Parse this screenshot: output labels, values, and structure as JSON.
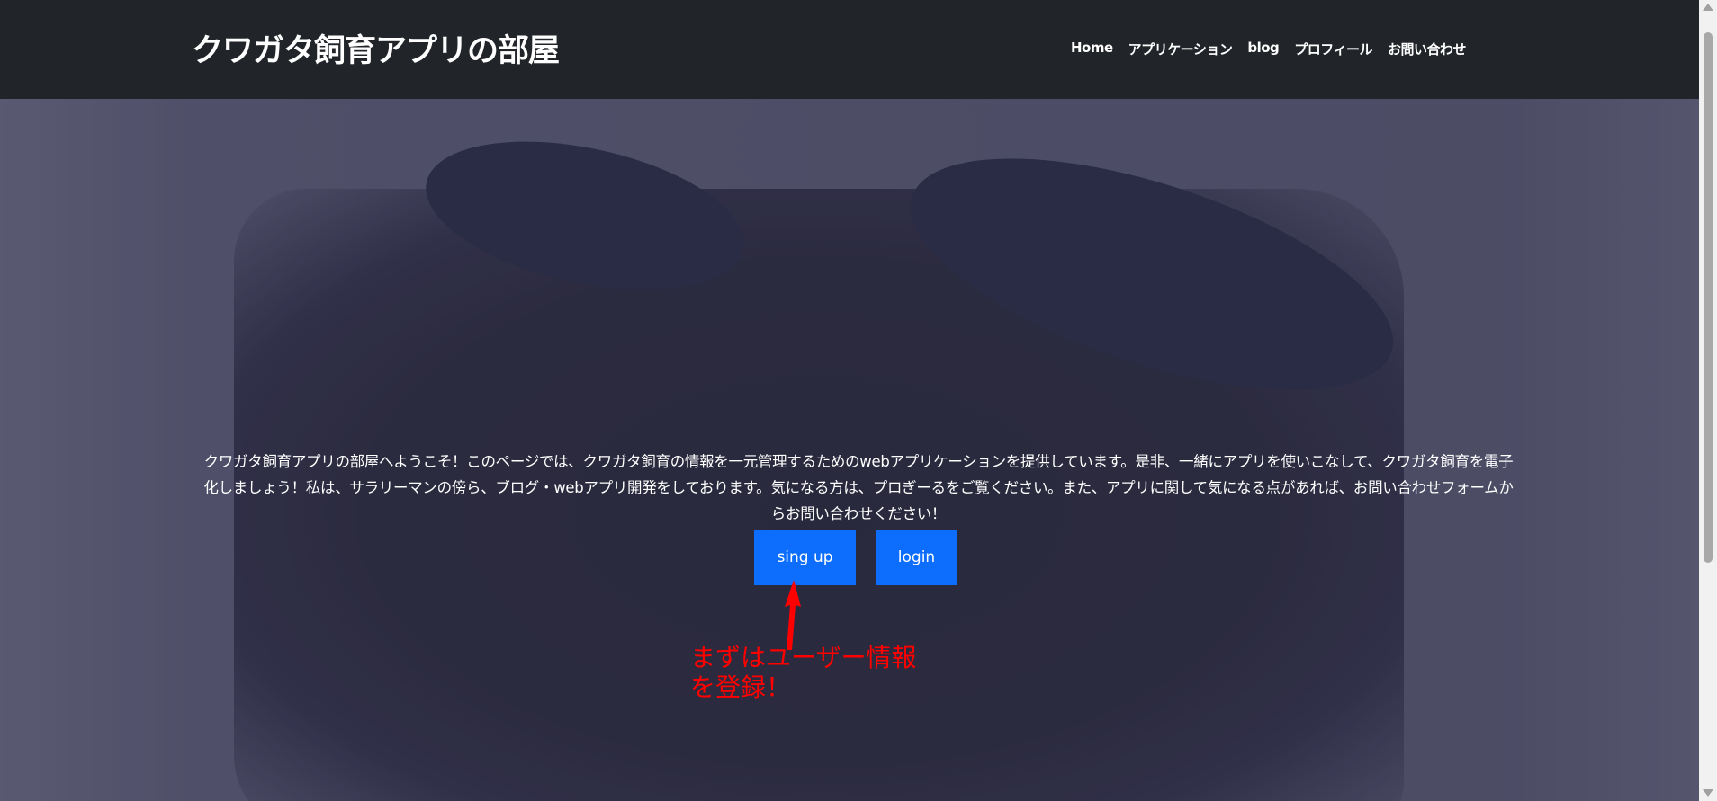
{
  "header": {
    "title": "クワガタ飼育アプリの部屋",
    "nav": [
      "Home",
      "アプリケーション",
      "blog",
      "プロフィール",
      "お問い合わせ"
    ]
  },
  "hero": {
    "intro": "クワガタ飼育アプリの部屋へようこそ！このページでは、クワガタ飼育の情報を一元管理するためのwebアプリケーションを提供しています。是非、一緒にアプリを使いこなして、クワガタ飼育を電子化しましょう！私は、サラリーマンの傍ら、ブログ・webアプリ開発をしております。気になる方は、プロぎーるをご覧ください。また、アプリに関して気になる点があれば、お問い合わせフォームからお問い合わせください！",
    "signup_label": "sing up",
    "login_label": "login",
    "annotation": "まずはユーザー情報\nを登録！",
    "button_color": "#0d6efd",
    "annotation_color": "#ff0000"
  }
}
